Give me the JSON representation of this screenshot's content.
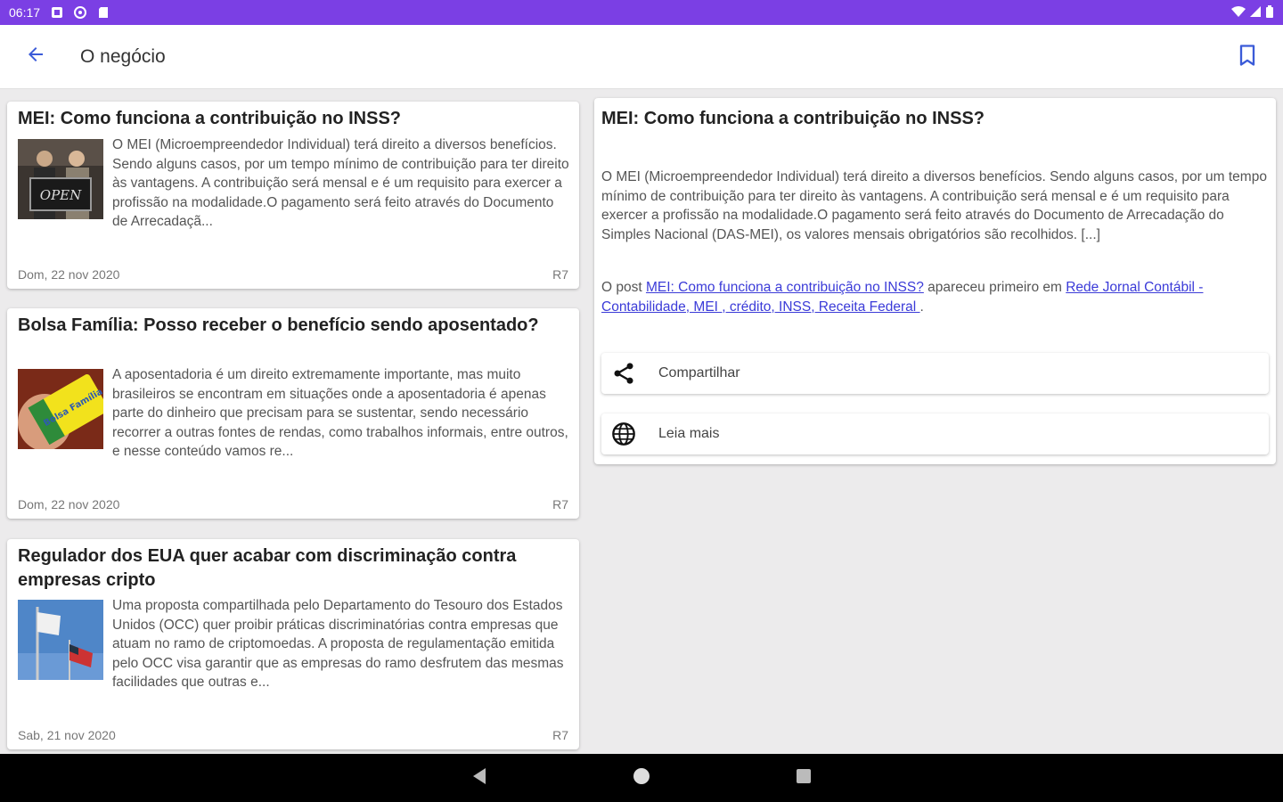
{
  "status_bar": {
    "time": "06:17"
  },
  "app_bar": {
    "title": "O negócio"
  },
  "articles": [
    {
      "title": "MEI: Como funciona a contribuição no INSS?",
      "excerpt": "O MEI (Microempreendedor Individual) terá direito a diversos benefícios. Sendo alguns casos, por um tempo mínimo de contribuição para ter direito às vantagens. A contribuição será mensal e é um requisito para exercer a profissão na modalidade.O pagamento será feito através do Documento de Arrecadaçã...",
      "date": "Dom, 22 nov 2020",
      "source": "R7",
      "image_text": "OPEN"
    },
    {
      "title": "Bolsa Família: Posso receber o benefício sendo aposentado?",
      "excerpt": "A aposentadoria é um direito extremamente importante, mas muito brasileiros se encontram em situações onde a aposentadoria é apenas parte do dinheiro que precisam para se sustentar, sendo necessário recorrer a outras fontes de rendas, como trabalhos informais, entre outros, e nesse conteúdo vamos re...",
      "date": "Dom, 22 nov 2020",
      "source": "R7",
      "image_text": "Bolsa Família"
    },
    {
      "title": "Regulador dos EUA quer acabar com discriminação contra empresas cripto",
      "excerpt": "Uma proposta compartilhada pelo Departamento do Tesouro dos Estados Unidos (OCC) quer proibir práticas discriminatórias contra empresas que atuam no ramo de criptomoedas. A proposta de regulamentação emitida pelo OCC visa garantir que as empresas do ramo desfrutem das mesmas facilidades que outras e...",
      "date": "Sab, 21 nov 2020",
      "source": "R7"
    }
  ],
  "detail": {
    "title": "MEI: Como funciona a contribuição no INSS?",
    "body": "O MEI (Microempreendedor Individual) terá direito a diversos benefícios. Sendo alguns casos, por um tempo mínimo de contribuição para ter direito às vantagens. A contribuição será mensal e é um requisito para exercer a profissão na modalidade.O pagamento será feito através do Documento de Arrecadação do Simples Nacional (DAS-MEI), os valores mensais obrigatórios são recolhidos. [...]",
    "post_prefix": "O post ",
    "post_link": "MEI: Como funciona a contribuição no INSS?",
    "post_middle": " apareceu primeiro em ",
    "site_link": "Rede Jornal Contábil - Contabilidade, MEI , crédito, INSS, Receita Federal ",
    "post_suffix": ".",
    "share_label": "Compartilhar",
    "read_more_label": "Leia mais"
  },
  "colors": {
    "status_bar": "#7b3fe4",
    "accent": "#3b5bd8",
    "link": "#3b3bd8"
  },
  "icons": {
    "back": "arrow-back-icon",
    "bookmark": "bookmark-icon",
    "share": "share-icon",
    "globe": "globe-icon"
  }
}
